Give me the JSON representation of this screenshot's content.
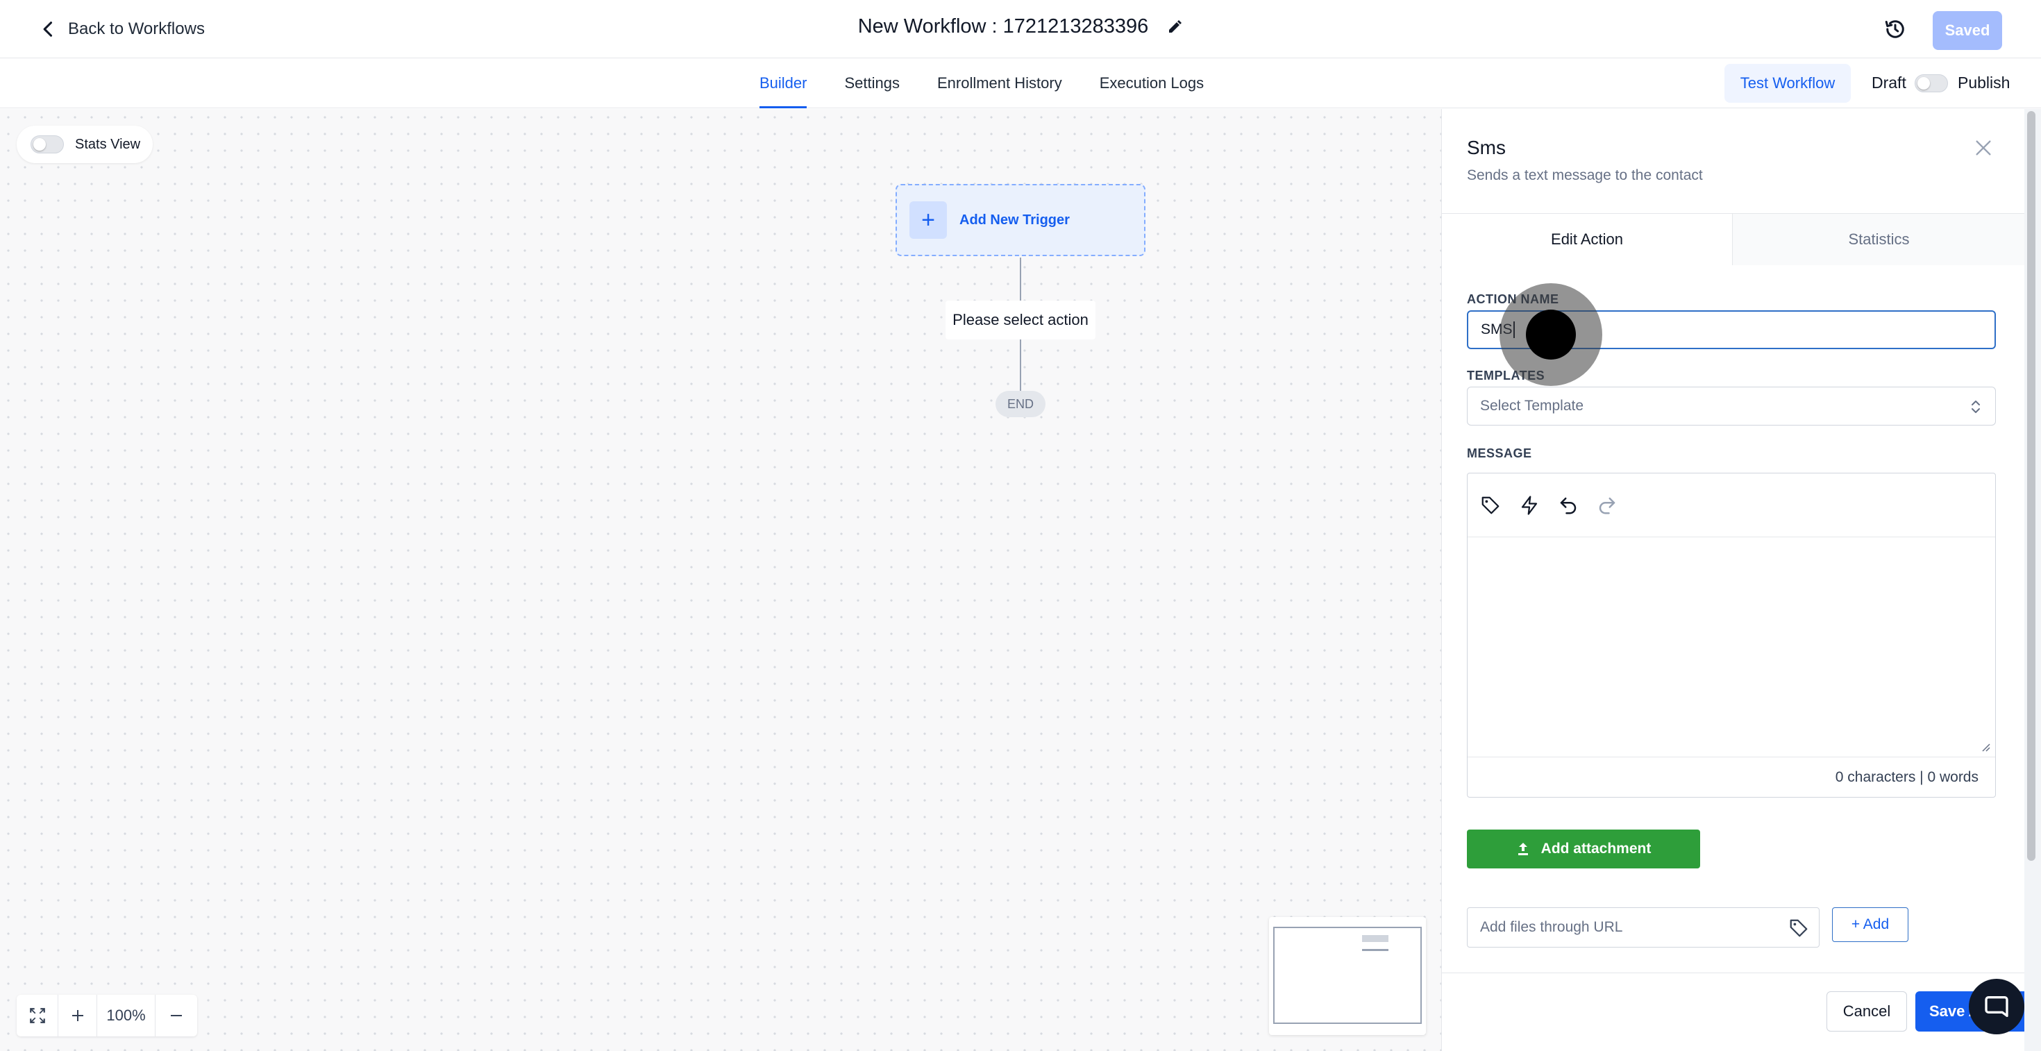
{
  "header": {
    "back_label": "Back to Workflows",
    "workflow_title": "New Workflow : 1721213283396",
    "saved_label": "Saved"
  },
  "nav": {
    "tabs": [
      {
        "label": "Builder",
        "active": true
      },
      {
        "label": "Settings",
        "active": false
      },
      {
        "label": "Enrollment History",
        "active": false
      },
      {
        "label": "Execution Logs",
        "active": false
      }
    ],
    "test_workflow_label": "Test Workflow",
    "draft_label": "Draft",
    "publish_label": "Publish",
    "publish_toggle_on": false
  },
  "canvas": {
    "stats_view_label": "Stats View",
    "stats_view_on": false,
    "trigger_label": "Add New Trigger",
    "action_placeholder": "Please select action",
    "end_label": "END",
    "zoom_level": "100%"
  },
  "panel": {
    "title": "Sms",
    "subtitle": "Sends a text message to the contact",
    "tabs": [
      "Edit Action",
      "Statistics"
    ],
    "action_name_label": "ACTION NAME",
    "action_name_value": "SMS",
    "templates_label": "TEMPLATES",
    "template_placeholder": "Select Template",
    "message_label": "MESSAGE",
    "message_count": "0 characters | 0 words",
    "add_attachment_label": "Add attachment",
    "url_placeholder": "Add files through URL",
    "add_url_label": "+ Add",
    "cancel_label": "Cancel",
    "save_label": "Save Action"
  },
  "colors": {
    "accent": "#155eef",
    "attachment_green": "#2e9e3a",
    "saved_disabled": "#a4bcfd"
  }
}
